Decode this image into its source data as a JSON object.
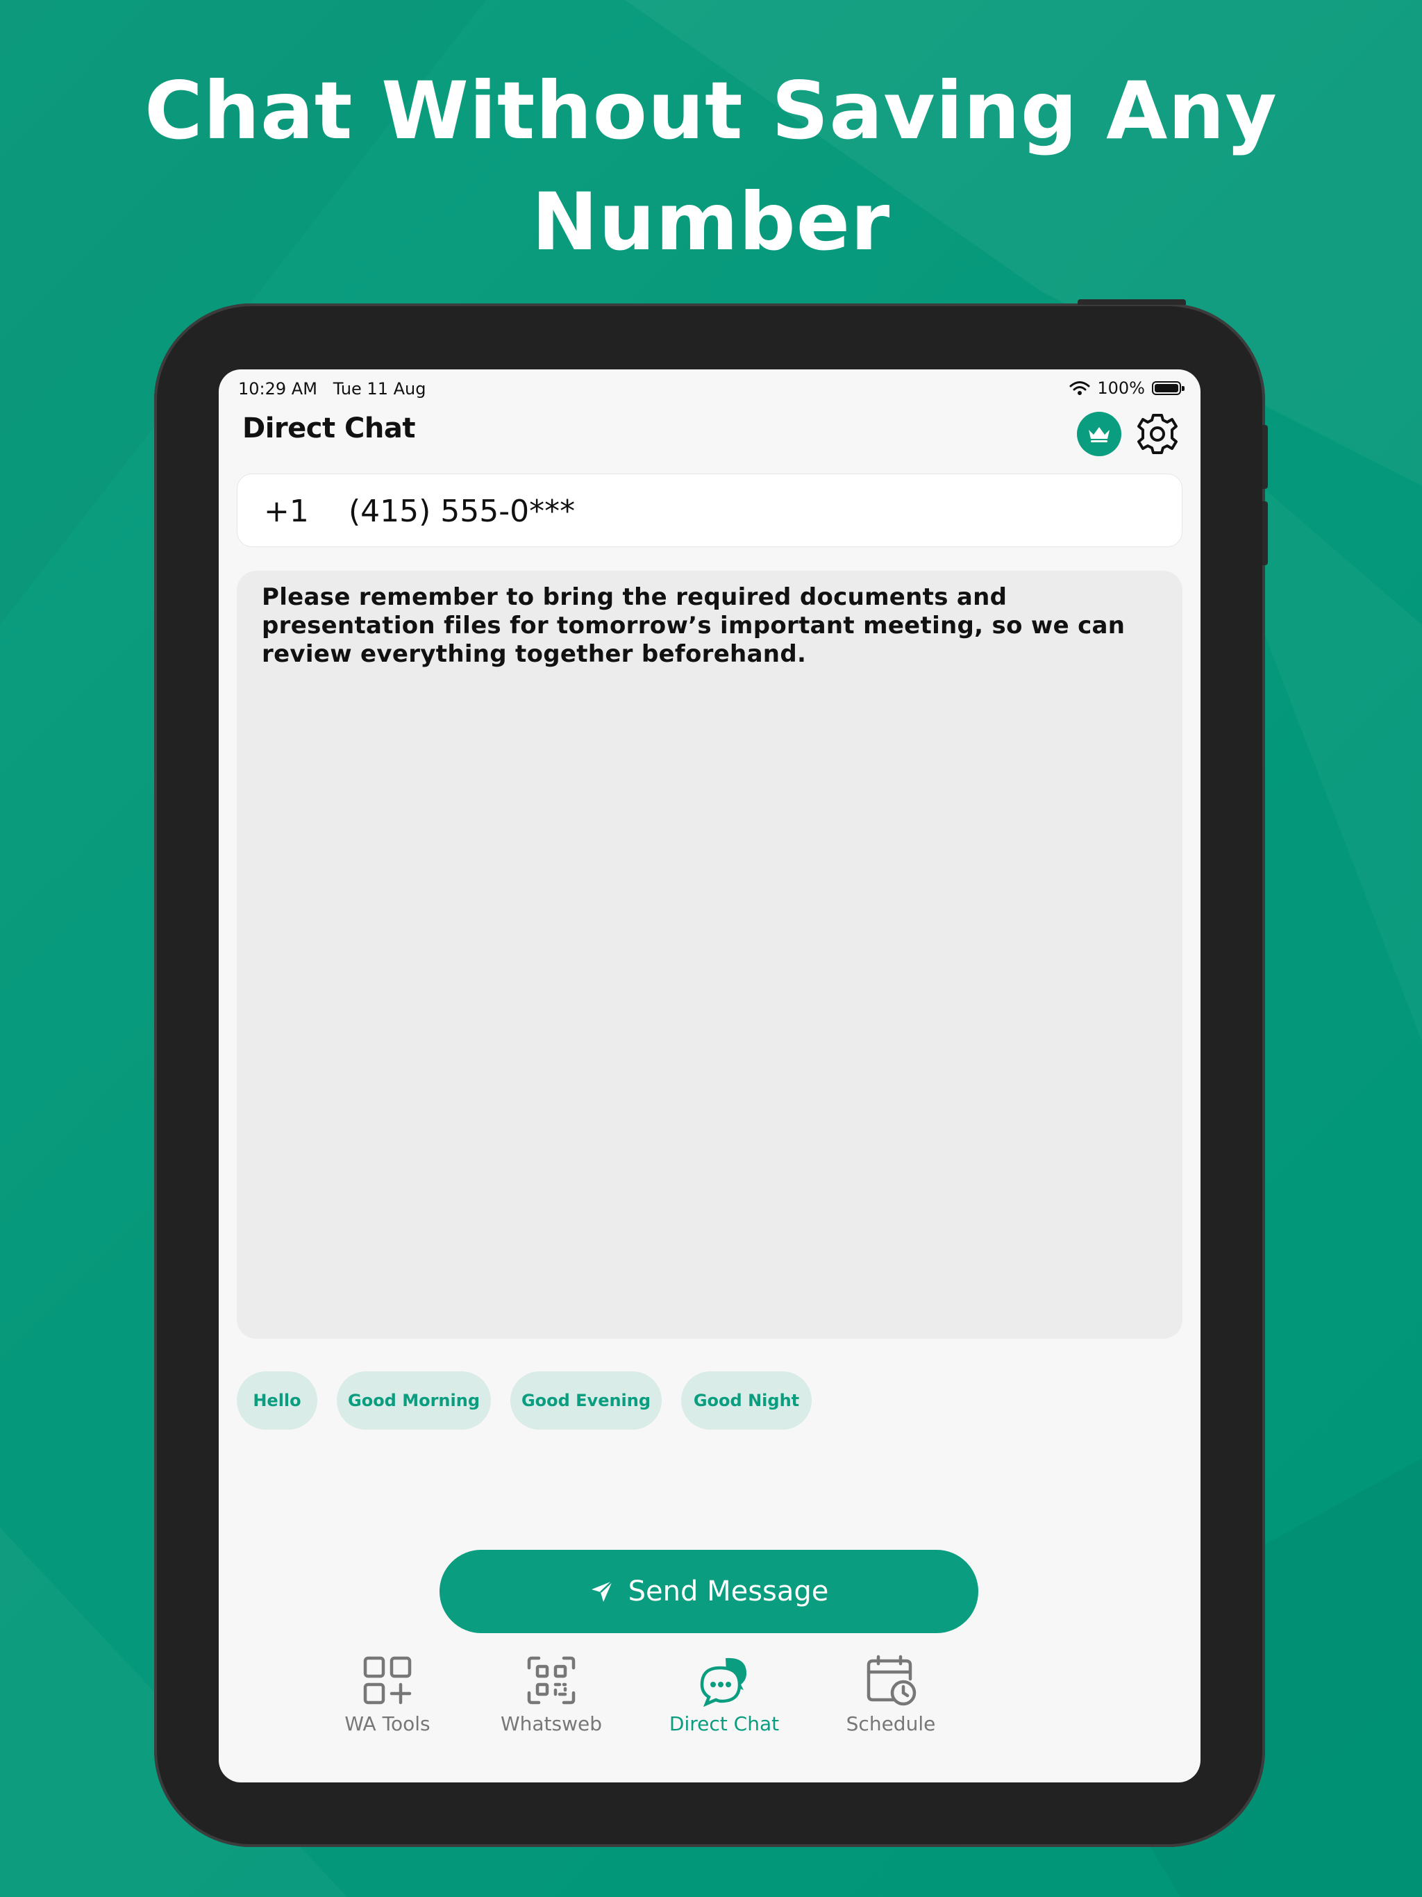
{
  "headline": {
    "line1": "Chat Without Saving Any",
    "line2": "Number"
  },
  "status_bar": {
    "time": "10:29 AM   Tue 11 Aug",
    "battery": "100%"
  },
  "nav": {
    "title": "Direct Chat",
    "premium_icon": "crown-icon",
    "settings_icon": "gear-icon"
  },
  "phone": {
    "country_code": "+1",
    "number": "(415) 555-0***"
  },
  "message": {
    "text": "Please remember to bring the required documents and presentation files for tomorrow’s important meeting, so we can review everything together beforehand."
  },
  "quick_replies": [
    "Hello",
    "Good Morning",
    "Good Evening",
    "Good Night"
  ],
  "send_button": {
    "label": "Send Message",
    "icon": "send-arrow-icon"
  },
  "tabs": [
    {
      "label": "WA Tools",
      "icon": "tools-grid-icon",
      "active": false
    },
    {
      "label": "Whatsweb",
      "icon": "qr-code-icon",
      "active": false
    },
    {
      "label": "Direct Chat",
      "icon": "chat-bubbles-icon",
      "active": true
    },
    {
      "label": "Schedule",
      "icon": "calendar-clock-icon",
      "active": false
    }
  ],
  "colors": {
    "accent": "#0a9d7f",
    "chip_bg": "#d9ece7",
    "background": "#06987a",
    "device": "#222222"
  }
}
